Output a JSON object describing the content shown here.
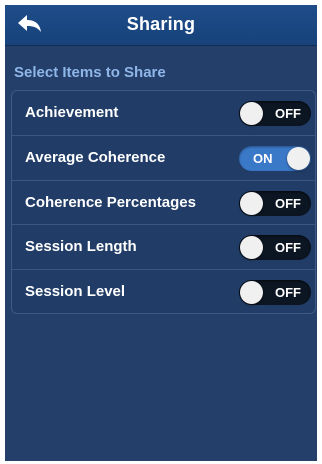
{
  "header": {
    "title": "Sharing",
    "back_icon": "back-arrow-icon"
  },
  "section": {
    "title": "Select Items to Share"
  },
  "items": [
    {
      "label": "Achievement",
      "state": "OFF",
      "on": false
    },
    {
      "label": "Average Coherence",
      "state": "ON",
      "on": true
    },
    {
      "label": "Coherence Percentages",
      "state": "OFF",
      "on": false
    },
    {
      "label": "Session Length",
      "state": "OFF",
      "on": false
    },
    {
      "label": "Session Level",
      "state": "OFF",
      "on": false
    }
  ],
  "colors": {
    "background": "#243f6a",
    "header": "#1b4682",
    "section_title": "#8fb6e8",
    "toggle_on": "#3a78c8",
    "toggle_off": "#0c1522"
  }
}
